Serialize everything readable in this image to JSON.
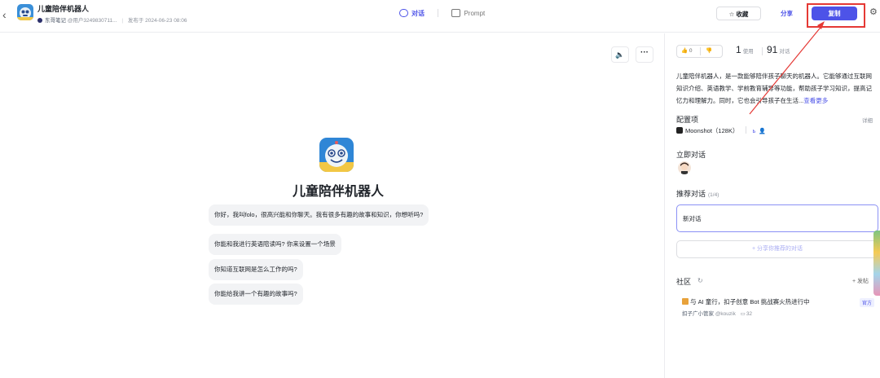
{
  "header": {
    "back_icon": "‹",
    "title": "儿童陪伴机器人",
    "author": "东哥笔记",
    "user_id": "@用户3249830711...",
    "published": "发布于 2024-06-23 08:06",
    "tabs": [
      {
        "label": "对话",
        "active": true
      },
      {
        "label": "Prompt",
        "active": false
      }
    ],
    "favorite_label": "☆ 收藏",
    "share_label": "分享",
    "copy_label": "复制",
    "accent_color": "#4d53e8"
  },
  "main": {
    "bot_name": "儿童陪伴机器人",
    "greeting": "你好，我叫folo，很高兴能和你聊天。我有很多有趣的故事和知识，你想听吗?",
    "suggestions": [
      "你能和我进行英语陪读吗? 你来设置一个场景",
      "你知道互联网是怎么工作的吗?",
      "你能给我讲一个有趣的故事吗?"
    ],
    "sound_icon": "🔈",
    "more_icon": "···"
  },
  "sidebar": {
    "likes": "0",
    "uses_value": "1",
    "uses_label": "使用",
    "chats_value": "91",
    "chats_label": "对话",
    "description": "儿童陪伴机器人，是一款能够陪伴孩子聊天的机器人。它能够通过互联网知识介绍、英语教学、学前教育辅导等功能，帮助孩子学习知识，提高记忆力和理解力。同时，它也会引导孩子在生活...",
    "view_more": "查看更多",
    "config_title": "配置项",
    "config_detail": "详细",
    "model": "Moonshot（128K）",
    "instant_chat_title": "立即对话",
    "recommend_title": "推荐对话",
    "recommend_count": "(1/4)",
    "new_chat": "新对话",
    "share_recommend": "+ 分享你推荐的对话",
    "community_title": "社区",
    "post_label": "+ 发帖",
    "feed": {
      "title": "与 AI 童行，扣子创意 Bot 挑战赛火热进行中",
      "badge": "官方",
      "author": "扣子广小管家",
      "handle": "@kouzik",
      "comments": "32"
    }
  }
}
